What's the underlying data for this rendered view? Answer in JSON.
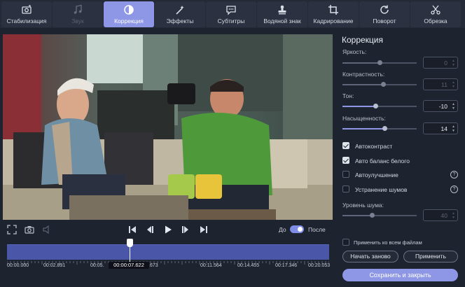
{
  "toolbar": {
    "tools": [
      {
        "label": "Стабилизация",
        "icon": "stabilize-icon",
        "state": "normal"
      },
      {
        "label": "Звук",
        "icon": "music-note-icon",
        "state": "disabled"
      },
      {
        "label": "Коррекция",
        "icon": "contrast-icon",
        "state": "active"
      },
      {
        "label": "Эффекты",
        "icon": "magic-wand-icon",
        "state": "normal"
      },
      {
        "label": "Субтитры",
        "icon": "speech-bubble-icon",
        "state": "normal"
      },
      {
        "label": "Водяной знак",
        "icon": "stamp-icon",
        "state": "normal"
      },
      {
        "label": "Кадрирование",
        "icon": "crop-icon",
        "state": "normal"
      },
      {
        "label": "Поворот",
        "icon": "rotate-icon",
        "state": "normal"
      },
      {
        "label": "Обрезка",
        "icon": "scissors-icon",
        "state": "normal"
      }
    ]
  },
  "controls": {
    "compare_before": "До",
    "compare_after": "После",
    "compare_toggle_on": true
  },
  "timeline": {
    "ticks": [
      "00:00.000",
      "00:02.891",
      "00:05.",
      "00:00:07.622",
      ".673",
      "00:11.564",
      "00:14.455",
      "00:17.346",
      "00:20.053"
    ],
    "current_time": "00:00:07.622",
    "position_fraction": 0.381
  },
  "panel": {
    "title": "Коррекция",
    "sliders": [
      {
        "label": "Яркость:",
        "value": "0",
        "level": 0.5,
        "enabled": false
      },
      {
        "label": "Контрастность:",
        "value": "11",
        "level": 0.55,
        "enabled": false
      },
      {
        "label": "Тон:",
        "value": "-10",
        "level": 0.45,
        "enabled": true
      },
      {
        "label": "Насыщенность:",
        "value": "14",
        "level": 0.57,
        "enabled": true
      }
    ],
    "checks": [
      {
        "label": "Автоконтраст",
        "checked": true,
        "help": false
      },
      {
        "label": "Авто баланс белого",
        "checked": true,
        "help": false
      },
      {
        "label": "Автоулучшение",
        "checked": false,
        "help": true
      },
      {
        "label": "Устранение шумов",
        "checked": false,
        "help": true
      }
    ],
    "noise": {
      "label": "Уровень шума:",
      "value": "40",
      "level": 0.4,
      "enabled": false
    },
    "apply_all_label": "Применить ко всем файлам",
    "reset_label": "Начать заново",
    "apply_label": "Применить",
    "save_label": "Сохранить и закрыть"
  },
  "colors": {
    "accent": "#8e97e6",
    "background": "#1e2330",
    "timeline": "#4a56a8"
  }
}
